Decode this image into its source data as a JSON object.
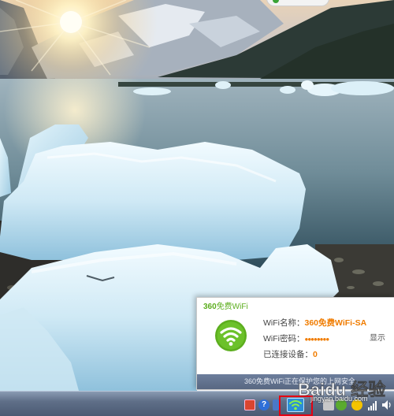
{
  "popup": {
    "brand_360": "360",
    "brand_rest": "免费WiFi",
    "name_label": "WiFi名称：",
    "name_value": "360免费WiFi-SA",
    "password_label": "WiFi密码：",
    "password_value": "●●●●●●●●",
    "devices_label": "已连接设备：",
    "devices_value": "0",
    "show_label": "显示",
    "footer_text": "360免费WiFi正在保护您的上网安全"
  },
  "watermark": {
    "site": "Baidu 经验",
    "url": "jingyan.baidu.com"
  },
  "taskbar": {
    "help_glyph": "?"
  },
  "colors": {
    "brand_green": "#5cae1e",
    "value_orange": "#f07c00",
    "highlight_red": "#e60012",
    "taskbar": "#5f6f88"
  }
}
